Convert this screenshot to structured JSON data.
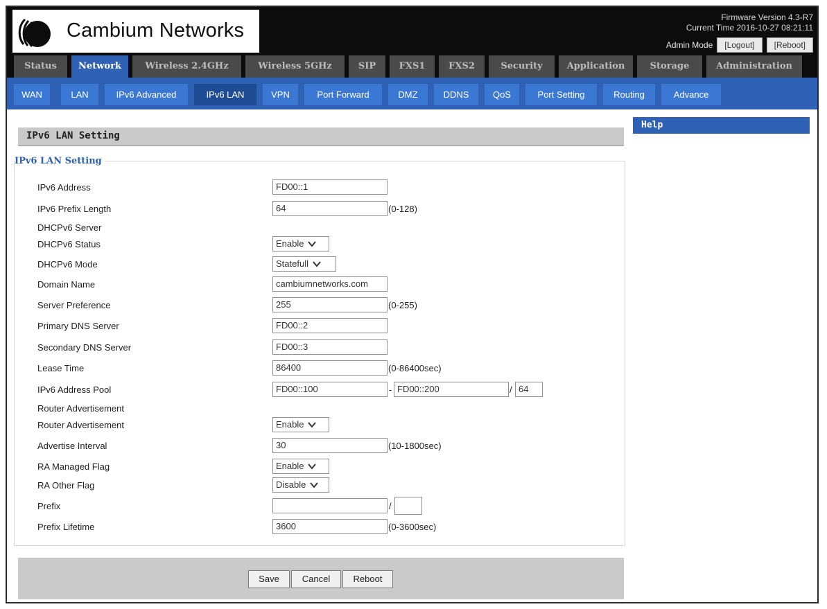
{
  "header": {
    "brand": "Cambium Networks",
    "firmware": "Firmware Version 4.3-R7",
    "current_time": "Current Time 2016-10-27 08:21:11",
    "admin_mode": "Admin Mode",
    "logout_label": "[Logout]",
    "reboot_label": "[Reboot]"
  },
  "main_tabs": [
    "Status",
    "Network",
    "Wireless 2.4GHz",
    "Wireless 5GHz",
    "SIP",
    "FXS1",
    "FXS2",
    "Security",
    "Application",
    "Storage",
    "Administration"
  ],
  "main_tab_active": "Network",
  "sub_tabs": [
    "WAN",
    "LAN",
    "IPv6 Advanced",
    "IPv6 LAN",
    "VPN",
    "Port Forward",
    "DMZ",
    "DDNS",
    "QoS",
    "Port Setting",
    "Routing",
    "Advance"
  ],
  "sub_tab_active": "IPv6 LAN",
  "page": {
    "title": "IPv6 LAN Setting",
    "legend": "IPv6 LAN Setting"
  },
  "form": {
    "ipv6_address": {
      "label": "IPv6 Address",
      "value": "FD00::1"
    },
    "prefix_length": {
      "label": "IPv6 Prefix Length",
      "value": "64",
      "note": "(0-128)"
    },
    "dhcpv6_server_heading": "DHCPv6 Server",
    "dhcpv6_status": {
      "label": "DHCPv6 Status",
      "value": "Enable"
    },
    "dhcpv6_mode": {
      "label": "DHCPv6 Mode",
      "value": "Statefull"
    },
    "domain_name": {
      "label": "Domain Name",
      "value": "cambiumnetworks.com"
    },
    "server_preference": {
      "label": "Server Preference",
      "value": "255",
      "note": "(0-255)"
    },
    "primary_dns": {
      "label": "Primary DNS Server",
      "value": "FD00::2"
    },
    "secondary_dns": {
      "label": "Secondary DNS Server",
      "value": "FD00::3"
    },
    "lease_time": {
      "label": "Lease Time",
      "value": "86400",
      "note": "(0-86400sec)"
    },
    "address_pool": {
      "label": "IPv6 Address Pool",
      "start": "FD00::100",
      "separator": "-",
      "end": "FD00::200",
      "slash": "/",
      "prefix": "64"
    },
    "router_advertisement_heading": "Router Advertisement",
    "router_advertisement": {
      "label": "Router Advertisement",
      "value": "Enable"
    },
    "advertise_interval": {
      "label": "Advertise Interval",
      "value": "30",
      "note": "(10-1800sec)"
    },
    "ra_managed_flag": {
      "label": "RA Managed Flag",
      "value": "Enable"
    },
    "ra_other_flag": {
      "label": "RA Other Flag",
      "value": "Disable"
    },
    "prefix": {
      "label": "Prefix",
      "value": "",
      "slash": "/",
      "length": ""
    },
    "prefix_lifetime": {
      "label": "Prefix Lifetime",
      "value": "3600",
      "note": "(0-3600sec)"
    }
  },
  "help": {
    "title": "Help"
  },
  "buttons": {
    "save": "Save",
    "cancel": "Cancel",
    "reboot": "Reboot"
  },
  "colors": {
    "tab_blue": "#2f62b5",
    "subtab_blue": "#3b78d3",
    "header_black": "#0c0c0c"
  },
  "icons": {
    "logo": "cambium-logo-icon",
    "dropdown": "chevron-down-icon"
  }
}
